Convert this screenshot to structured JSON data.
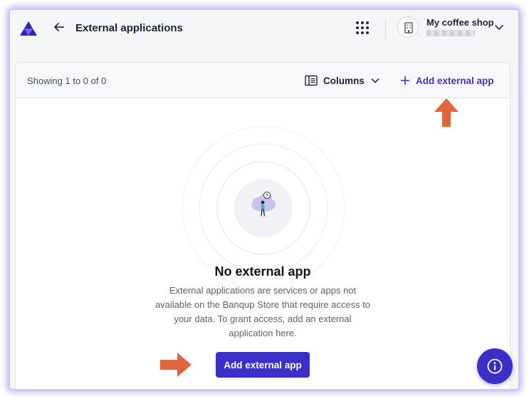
{
  "header": {
    "title": "External applications",
    "shop_name": "My coffee shop"
  },
  "toolbar": {
    "showing_text": "Showing 1 to 0 of 0",
    "columns_label": "Columns",
    "add_link_label": "Add external app"
  },
  "empty_state": {
    "title": "No external app",
    "description": "External applications are services or apps not available on the Banqup Store that require access to your data. To grant access, add an external application here.",
    "button_label": "Add external app"
  },
  "colors": {
    "accent": "#3b2fc9",
    "link": "#3b34c5",
    "annotation_arrow": "#e0643c"
  },
  "icons": {
    "logo": "triangle-logo-icon",
    "back": "arrow-left-icon",
    "apps": "grid-dots-icon",
    "shop": "building-icon",
    "chevron": "chevron-down-icon",
    "columns": "columns-icon",
    "add": "plus-icon",
    "help": "info-icon"
  }
}
